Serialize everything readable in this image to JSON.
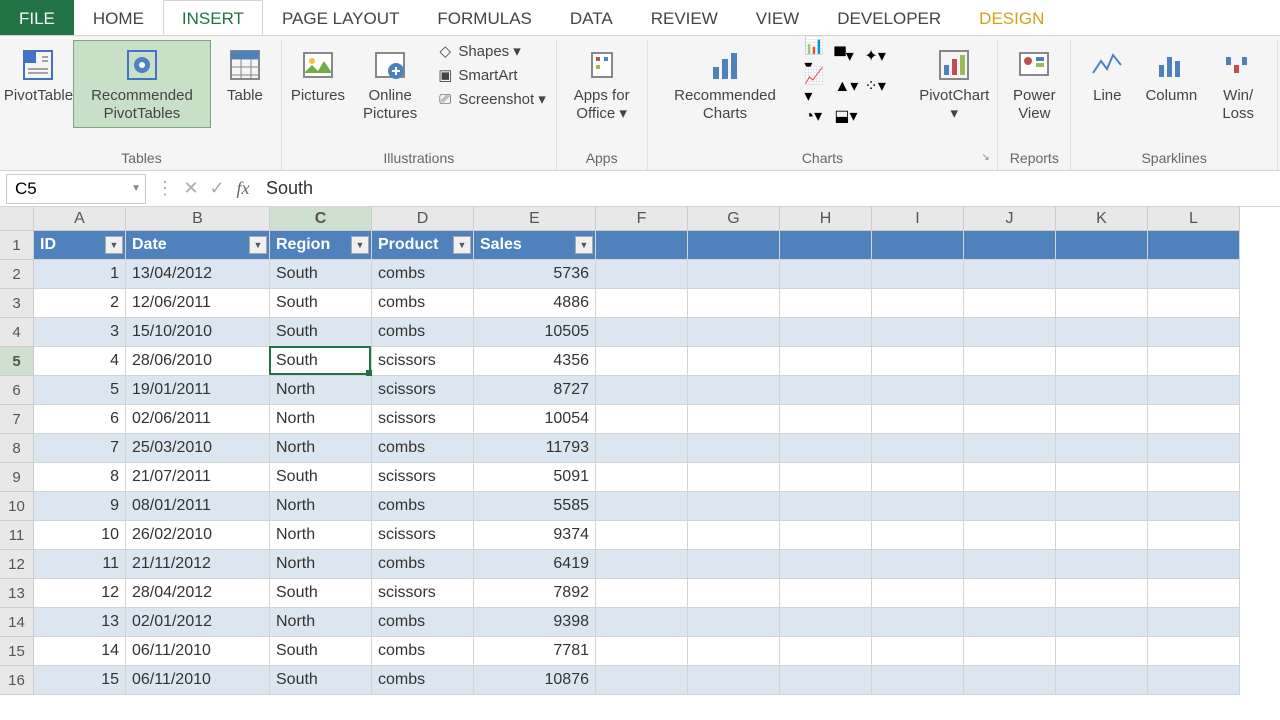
{
  "tabs": {
    "file": "FILE",
    "home": "HOME",
    "insert": "INSERT",
    "page_layout": "PAGE LAYOUT",
    "formulas": "FORMULAS",
    "data": "DATA",
    "review": "REVIEW",
    "view": "VIEW",
    "developer": "DEVELOPER",
    "design": "DESIGN"
  },
  "ribbon": {
    "tables": {
      "pivot": "PivotTable",
      "rec_pivot": "Recommended PivotTables",
      "table": "Table",
      "group": "Tables"
    },
    "illustrations": {
      "pictures": "Pictures",
      "online": "Online Pictures",
      "shapes": "Shapes",
      "smartart": "SmartArt",
      "screenshot": "Screenshot",
      "group": "Illustrations"
    },
    "apps": {
      "apps": "Apps for Office",
      "group": "Apps"
    },
    "charts": {
      "rec": "Recommended Charts",
      "pivotchart": "PivotChart",
      "group": "Charts"
    },
    "reports": {
      "power": "Power View",
      "group": "Reports"
    },
    "sparklines": {
      "line": "Line",
      "column": "Column",
      "winloss": "Win/\nLoss",
      "group": "Sparklines"
    }
  },
  "name_box": "C5",
  "formula": "South",
  "columns": [
    "A",
    "B",
    "C",
    "D",
    "E",
    "F",
    "G",
    "H",
    "I",
    "J",
    "K",
    "L"
  ],
  "headers": [
    "ID",
    "Date",
    "Region",
    "Product",
    "Sales"
  ],
  "rows": [
    {
      "id": 1,
      "date": "13/04/2012",
      "region": "South",
      "product": "combs",
      "sales": 5736
    },
    {
      "id": 2,
      "date": "12/06/2011",
      "region": "South",
      "product": "combs",
      "sales": 4886
    },
    {
      "id": 3,
      "date": "15/10/2010",
      "region": "South",
      "product": "combs",
      "sales": 10505
    },
    {
      "id": 4,
      "date": "28/06/2010",
      "region": "South",
      "product": "scissors",
      "sales": 4356
    },
    {
      "id": 5,
      "date": "19/01/2011",
      "region": "North",
      "product": "scissors",
      "sales": 8727
    },
    {
      "id": 6,
      "date": "02/06/2011",
      "region": "North",
      "product": "scissors",
      "sales": 10054
    },
    {
      "id": 7,
      "date": "25/03/2010",
      "region": "North",
      "product": "combs",
      "sales": 11793
    },
    {
      "id": 8,
      "date": "21/07/2011",
      "region": "South",
      "product": "scissors",
      "sales": 5091
    },
    {
      "id": 9,
      "date": "08/01/2011",
      "region": "North",
      "product": "combs",
      "sales": 5585
    },
    {
      "id": 10,
      "date": "26/02/2010",
      "region": "North",
      "product": "scissors",
      "sales": 9374
    },
    {
      "id": 11,
      "date": "21/11/2012",
      "region": "North",
      "product": "combs",
      "sales": 6419
    },
    {
      "id": 12,
      "date": "28/04/2012",
      "region": "South",
      "product": "scissors",
      "sales": 7892
    },
    {
      "id": 13,
      "date": "02/01/2012",
      "region": "North",
      "product": "combs",
      "sales": 9398
    },
    {
      "id": 14,
      "date": "06/11/2010",
      "region": "South",
      "product": "combs",
      "sales": 7781
    },
    {
      "id": 15,
      "date": "06/11/2010",
      "region": "South",
      "product": "combs",
      "sales": 10876
    }
  ],
  "selected": {
    "ref": "C5",
    "row": 5,
    "col": "C"
  }
}
